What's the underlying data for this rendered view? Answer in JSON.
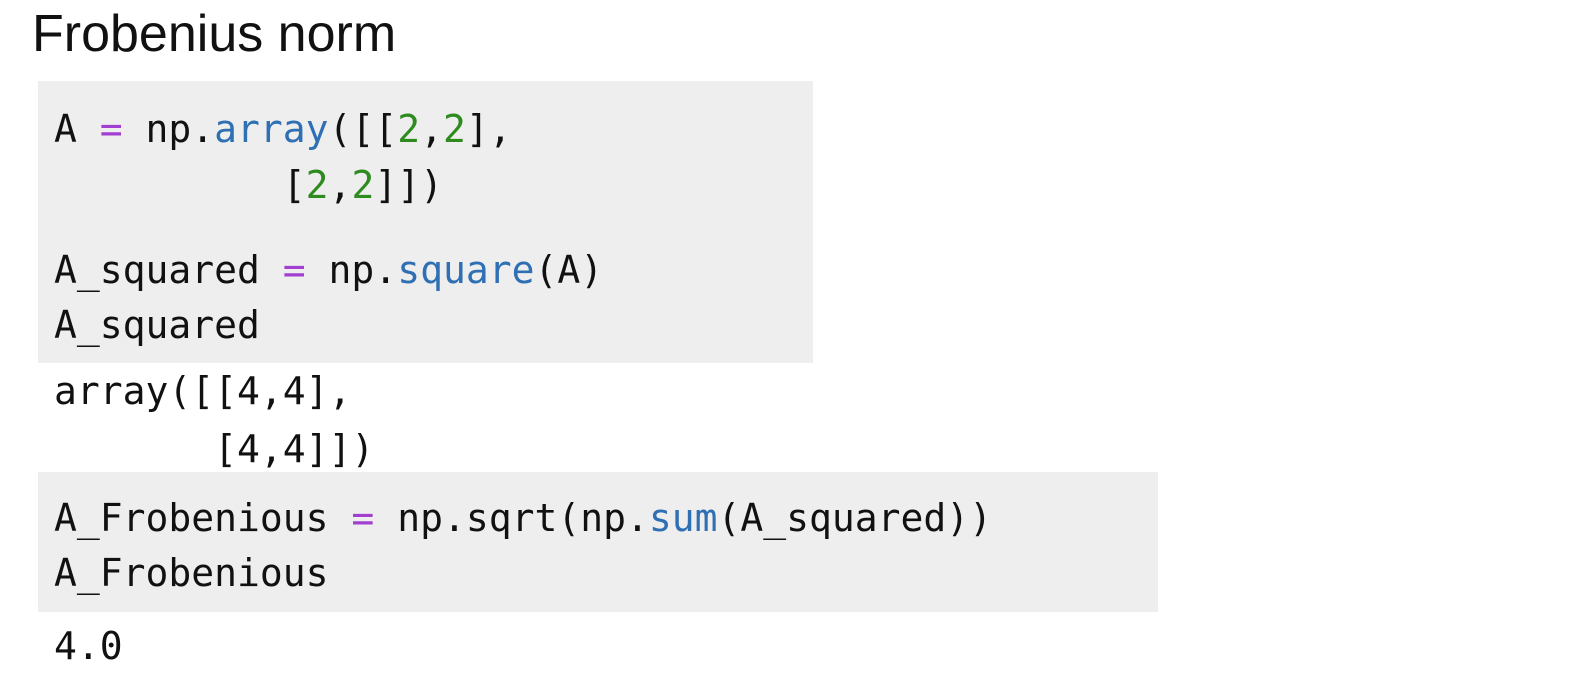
{
  "page_title": "Frobenius norm",
  "cell1": {
    "line1": {
      "var": "A",
      "op": " = ",
      "obj": "np.",
      "fn": "array",
      "open": "([[",
      "n1": "2",
      "sep1": ",",
      "n2": "2",
      "close": "],"
    },
    "line2": {
      "indent": "          ",
      "open": "[",
      "n1": "2",
      "sep1": ",",
      "n2": "2",
      "close": "]])"
    },
    "line3": {
      "var": "A_squared",
      "op": " = ",
      "obj": "np.",
      "fn": "square",
      "args": "(A)"
    },
    "line4": "A_squared"
  },
  "output1": {
    "line1": "array([[4,4],",
    "line2": "       [4,4]])"
  },
  "cell2": {
    "line1": {
      "var": "A_Frobenious",
      "op": " = ",
      "pre": "np.sqrt(np.",
      "fn": "sum",
      "args": "(A_squared))"
    },
    "line2": "A_Frobenious"
  },
  "output2": "4.0",
  "colors": {
    "cell_background": "#eeeeee",
    "operator": "#a23fd0",
    "function": "#2f6fb3",
    "number": "#2e8b1e"
  }
}
